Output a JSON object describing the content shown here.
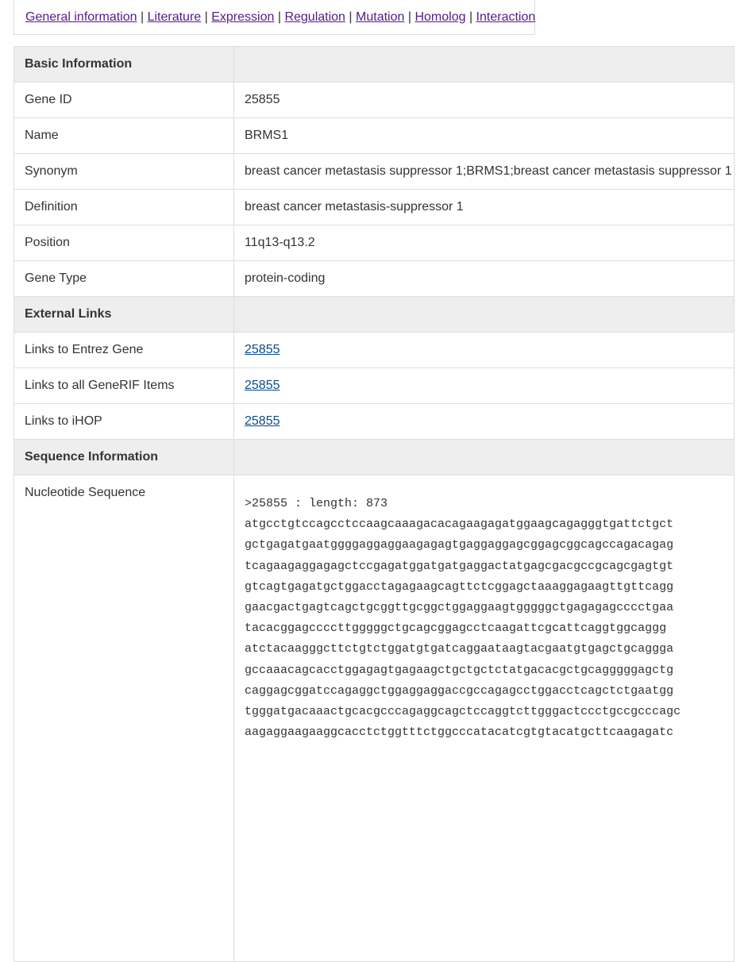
{
  "nav": {
    "links": [
      "General information",
      "Literature",
      "Expression",
      "Regulation",
      "Mutation",
      "Homolog",
      "Interaction"
    ],
    "separator": "|"
  },
  "table": {
    "basic_header": "Basic Information",
    "gene_id": {
      "label": "Gene ID",
      "value": "25855"
    },
    "name": {
      "label": "Name",
      "value": "BRMS1"
    },
    "synonym": {
      "label": "Synonym",
      "value": "breast cancer metastasis suppressor 1;BRMS1;breast cancer metastasis suppressor 1"
    },
    "definition": {
      "label": "Definition",
      "value": "breast cancer metastasis-suppressor 1"
    },
    "position": {
      "label": "Position",
      "value": "11q13-q13.2"
    },
    "gene_type": {
      "label": "Gene Type",
      "value": "protein-coding"
    },
    "external_header": "External Links",
    "entrez": {
      "label": "Links to Entrez Gene",
      "value": "25855"
    },
    "generif": {
      "label": "Links to all GeneRIF Items",
      "value": "25855"
    },
    "ihop": {
      "label": "Links to iHOP",
      "value": "25855"
    },
    "sequence_header": "Sequence Information",
    "nucleotide": {
      "label": "Nucleotide Sequence",
      "lines": [
        ">25855 : length: 873",
        "atgcctgtccagcctccaagcaaagacacagaagagatggaagcagagggtgattctgct",
        "gctgagatgaatggggaggaggaagagagtgaggaggagcggagcggcagccagacagag",
        "tcagaagaggagagctccgagatggatgatgaggactatgagcgacgccgcagcgagtgt",
        "gtcagtgagatgctggacctagagaagcagttctcggagctaaaggagaagttgttcagg",
        "gaacgactgagtcagctgcggttgcggctggaggaagtgggggctgagagagcccctgaa",
        "tacacggagccccttgggggctgcagcggagcctcaagattcgcattcaggtggcaggg",
        "atctacaagggcttctgtctggatgtgatcaggaataagtacgaatgtgagctgcaggga",
        "gccaaacagcacctggagagtgagaagctgctgctctatgacacgctgcagggggagctg",
        "caggagcggatccagaggctggaggaggaccgccagagcctggacctcagctctgaatgg",
        "tgggatgacaaactgcacgcccagaggcagctccaggtcttgggactccctgccgcccagc",
        "aagaggaagaaggcacctctggtttctggcccatacatcgtgtacatgcttcaagagatc"
      ]
    }
  }
}
